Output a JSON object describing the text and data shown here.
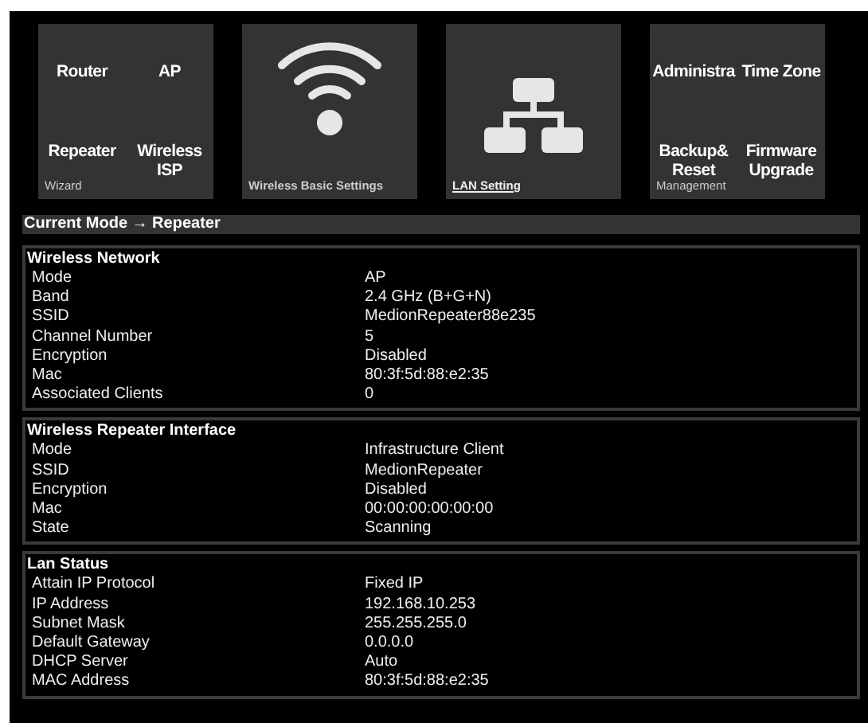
{
  "tiles": [
    {
      "kind": "links",
      "caption": "Wizard",
      "selected": false,
      "links": [
        "Router",
        "AP",
        "Repeater",
        "Wireless ISP"
      ]
    },
    {
      "kind": "wifi",
      "caption": "Wireless Basic Settings",
      "selected": false
    },
    {
      "kind": "network",
      "caption": "LAN Setting",
      "selected": true
    },
    {
      "kind": "links",
      "caption": "Management",
      "selected": false,
      "links": [
        "Administra",
        "Time Zone",
        "Backup& Reset",
        "Firmware Upgrade"
      ]
    }
  ],
  "current_mode": "Current Mode → Repeater",
  "sections": [
    {
      "title": "Wireless Network",
      "rows": [
        [
          "Mode",
          "AP"
        ],
        [
          "Band",
          "2.4 GHz (B+G+N)"
        ],
        [
          "SSID",
          "MedionRepeater88e235"
        ],
        [
          "Channel Number",
          "5"
        ],
        [
          "Encryption",
          "Disabled"
        ],
        [
          "Mac",
          "80:3f:5d:88:e2:35"
        ],
        [
          "Associated Clients",
          "0"
        ]
      ]
    },
    {
      "title": "Wireless Repeater Interface",
      "rows": [
        [
          "Mode",
          "Infrastructure Client"
        ],
        [
          "SSID",
          "MedionRepeater"
        ],
        [
          "Encryption",
          "Disabled"
        ],
        [
          "Mac",
          "00:00:00:00:00:00"
        ],
        [
          "State",
          "Scanning"
        ]
      ]
    },
    {
      "title": "Lan Status",
      "rows": [
        [
          "Attain IP Protocol",
          "Fixed IP"
        ],
        [
          "IP Address",
          "192.168.10.253"
        ],
        [
          "Subnet Mask",
          "255.255.255.0"
        ],
        [
          "Default Gateway",
          "0.0.0.0"
        ],
        [
          "DHCP Server",
          "Auto"
        ],
        [
          "MAC Address",
          "80:3f:5d:88:e2:35"
        ]
      ]
    }
  ]
}
